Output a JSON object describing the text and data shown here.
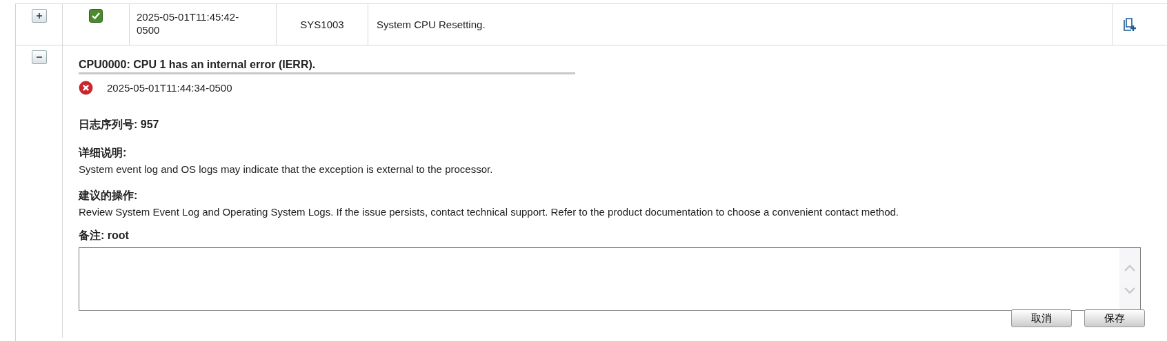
{
  "rows": [
    {
      "expanded": false,
      "failed": false,
      "time": "2025-05-01T11:45:42-0500",
      "event_id": "SYS1003",
      "message": "System CPU Resetting."
    }
  ],
  "detail": {
    "expanded": true,
    "title": "CPU0000: CPU 1 has an internal error (IERR).",
    "failed": true,
    "time": "2025-05-01T11:44:34-0500",
    "sequence": "日志序列号: 957",
    "sections": [
      {
        "heading": "详细说明:",
        "text": "System event log and OS logs may indicate that the exception is external to the processor."
      },
      {
        "heading": "建议的操作:",
        "text": "Review System Event Log and Operating System Logs. If the issue persists, contact technical support. Refer to the product documentation to choose a convenient contact method."
      }
    ],
    "note": "备注: root",
    "buttons": [
      "取消",
      "保存"
    ]
  }
}
